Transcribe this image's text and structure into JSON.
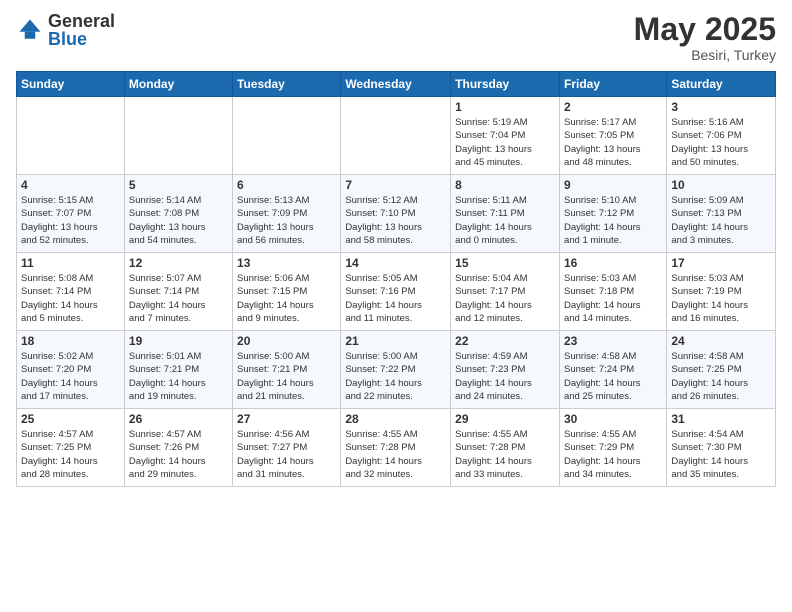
{
  "header": {
    "logo_general": "General",
    "logo_blue": "Blue",
    "title": "May 2025",
    "location": "Besiri, Turkey"
  },
  "days": [
    "Sunday",
    "Monday",
    "Tuesday",
    "Wednesday",
    "Thursday",
    "Friday",
    "Saturday"
  ],
  "weeks": [
    [
      {
        "date": "",
        "info": ""
      },
      {
        "date": "",
        "info": ""
      },
      {
        "date": "",
        "info": ""
      },
      {
        "date": "",
        "info": ""
      },
      {
        "date": "1",
        "info": "Sunrise: 5:19 AM\nSunset: 7:04 PM\nDaylight: 13 hours\nand 45 minutes."
      },
      {
        "date": "2",
        "info": "Sunrise: 5:17 AM\nSunset: 7:05 PM\nDaylight: 13 hours\nand 48 minutes."
      },
      {
        "date": "3",
        "info": "Sunrise: 5:16 AM\nSunset: 7:06 PM\nDaylight: 13 hours\nand 50 minutes."
      }
    ],
    [
      {
        "date": "4",
        "info": "Sunrise: 5:15 AM\nSunset: 7:07 PM\nDaylight: 13 hours\nand 52 minutes."
      },
      {
        "date": "5",
        "info": "Sunrise: 5:14 AM\nSunset: 7:08 PM\nDaylight: 13 hours\nand 54 minutes."
      },
      {
        "date": "6",
        "info": "Sunrise: 5:13 AM\nSunset: 7:09 PM\nDaylight: 13 hours\nand 56 minutes."
      },
      {
        "date": "7",
        "info": "Sunrise: 5:12 AM\nSunset: 7:10 PM\nDaylight: 13 hours\nand 58 minutes."
      },
      {
        "date": "8",
        "info": "Sunrise: 5:11 AM\nSunset: 7:11 PM\nDaylight: 14 hours\nand 0 minutes."
      },
      {
        "date": "9",
        "info": "Sunrise: 5:10 AM\nSunset: 7:12 PM\nDaylight: 14 hours\nand 1 minute."
      },
      {
        "date": "10",
        "info": "Sunrise: 5:09 AM\nSunset: 7:13 PM\nDaylight: 14 hours\nand 3 minutes."
      }
    ],
    [
      {
        "date": "11",
        "info": "Sunrise: 5:08 AM\nSunset: 7:14 PM\nDaylight: 14 hours\nand 5 minutes."
      },
      {
        "date": "12",
        "info": "Sunrise: 5:07 AM\nSunset: 7:14 PM\nDaylight: 14 hours\nand 7 minutes."
      },
      {
        "date": "13",
        "info": "Sunrise: 5:06 AM\nSunset: 7:15 PM\nDaylight: 14 hours\nand 9 minutes."
      },
      {
        "date": "14",
        "info": "Sunrise: 5:05 AM\nSunset: 7:16 PM\nDaylight: 14 hours\nand 11 minutes."
      },
      {
        "date": "15",
        "info": "Sunrise: 5:04 AM\nSunset: 7:17 PM\nDaylight: 14 hours\nand 12 minutes."
      },
      {
        "date": "16",
        "info": "Sunrise: 5:03 AM\nSunset: 7:18 PM\nDaylight: 14 hours\nand 14 minutes."
      },
      {
        "date": "17",
        "info": "Sunrise: 5:03 AM\nSunset: 7:19 PM\nDaylight: 14 hours\nand 16 minutes."
      }
    ],
    [
      {
        "date": "18",
        "info": "Sunrise: 5:02 AM\nSunset: 7:20 PM\nDaylight: 14 hours\nand 17 minutes."
      },
      {
        "date": "19",
        "info": "Sunrise: 5:01 AM\nSunset: 7:21 PM\nDaylight: 14 hours\nand 19 minutes."
      },
      {
        "date": "20",
        "info": "Sunrise: 5:00 AM\nSunset: 7:21 PM\nDaylight: 14 hours\nand 21 minutes."
      },
      {
        "date": "21",
        "info": "Sunrise: 5:00 AM\nSunset: 7:22 PM\nDaylight: 14 hours\nand 22 minutes."
      },
      {
        "date": "22",
        "info": "Sunrise: 4:59 AM\nSunset: 7:23 PM\nDaylight: 14 hours\nand 24 minutes."
      },
      {
        "date": "23",
        "info": "Sunrise: 4:58 AM\nSunset: 7:24 PM\nDaylight: 14 hours\nand 25 minutes."
      },
      {
        "date": "24",
        "info": "Sunrise: 4:58 AM\nSunset: 7:25 PM\nDaylight: 14 hours\nand 26 minutes."
      }
    ],
    [
      {
        "date": "25",
        "info": "Sunrise: 4:57 AM\nSunset: 7:25 PM\nDaylight: 14 hours\nand 28 minutes."
      },
      {
        "date": "26",
        "info": "Sunrise: 4:57 AM\nSunset: 7:26 PM\nDaylight: 14 hours\nand 29 minutes."
      },
      {
        "date": "27",
        "info": "Sunrise: 4:56 AM\nSunset: 7:27 PM\nDaylight: 14 hours\nand 31 minutes."
      },
      {
        "date": "28",
        "info": "Sunrise: 4:55 AM\nSunset: 7:28 PM\nDaylight: 14 hours\nand 32 minutes."
      },
      {
        "date": "29",
        "info": "Sunrise: 4:55 AM\nSunset: 7:28 PM\nDaylight: 14 hours\nand 33 minutes."
      },
      {
        "date": "30",
        "info": "Sunrise: 4:55 AM\nSunset: 7:29 PM\nDaylight: 14 hours\nand 34 minutes."
      },
      {
        "date": "31",
        "info": "Sunrise: 4:54 AM\nSunset: 7:30 PM\nDaylight: 14 hours\nand 35 minutes."
      }
    ]
  ]
}
